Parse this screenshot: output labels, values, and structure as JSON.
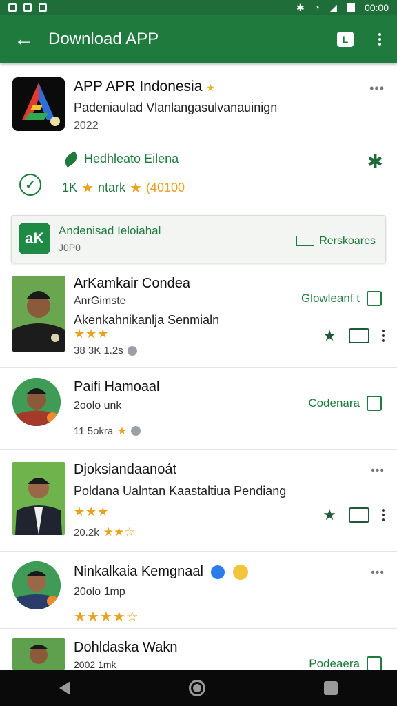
{
  "status_bar": {
    "time": "00:00"
  },
  "app_bar": {
    "title": "Download APP",
    "back_icon": "arrow-left-icon",
    "chat_icon_letter": "L"
  },
  "header_app": {
    "name": "APP APR Indonesia",
    "subtitle": "Padeniaulad Vlanlangasulvanauinign",
    "year": "2022",
    "more": "•••",
    "feature_text": "Hedhleato Eilena",
    "stat_count": "1K",
    "stat_label": "ntark",
    "stat_amount": "(40100",
    "accent": "#1e7a3d",
    "star_color": "#e8a21f"
  },
  "banner": {
    "icon_text": "aK",
    "title": "Andenisad Ieloiahal",
    "subtitle": "J0P0",
    "action": "Rerskoares"
  },
  "list": [
    {
      "name": "ArKamkair Condea",
      "line2": "AnrGimste",
      "line3": "Akenkahnikanlja Senmialn",
      "rating_stars": "★★★",
      "meta": "38 3K  1.2s",
      "download_label": "Glowleanf t"
    },
    {
      "name": "Paifi Hamoaal",
      "line2": "2oolo unk",
      "meta": "11 5okra",
      "download_label": "Codenara"
    },
    {
      "name": "Djoksiandaanoát",
      "line2": "Poldana Ualntan Kaastaltiua Pendiang",
      "rating_stars": "★★★",
      "meta": "20.2k",
      "meta_stars": "★★☆",
      "more": "•••"
    },
    {
      "name": "Ninkalkaia Kemgnaal",
      "line2": "20olo 1mp",
      "rating_stars": "★★★★☆",
      "more": "•••"
    },
    {
      "name": "Dohldaska Wakn",
      "line2": "2002 1mk",
      "download_label": "Podeaera"
    }
  ]
}
